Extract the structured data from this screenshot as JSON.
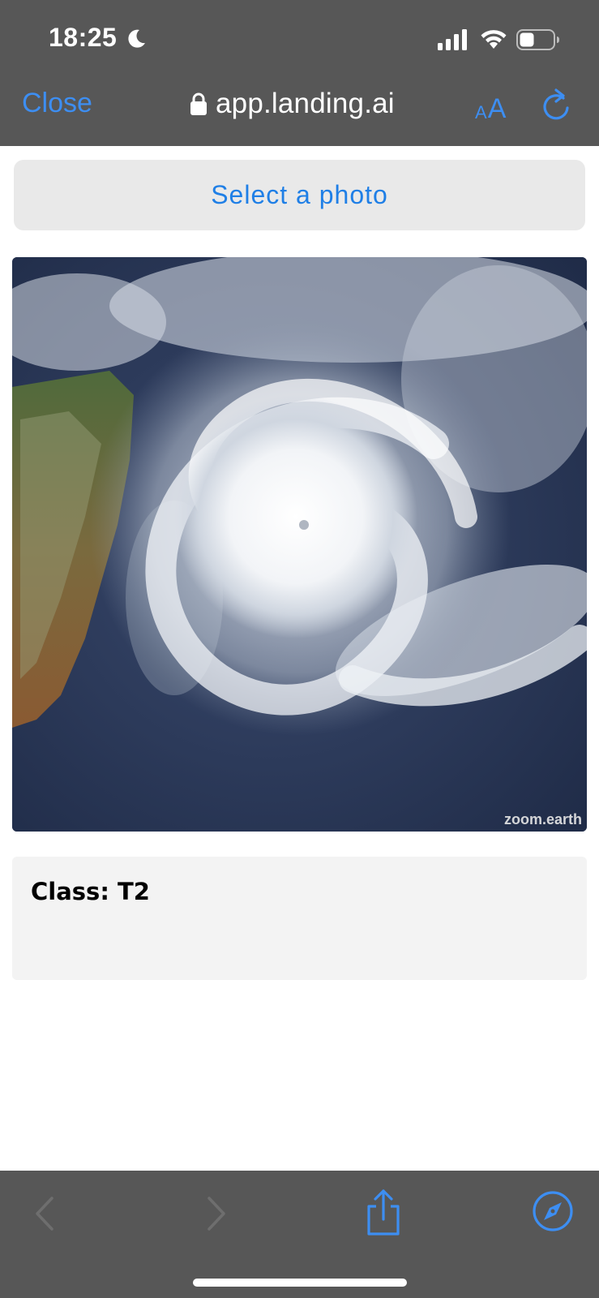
{
  "status_bar": {
    "time": "18:25",
    "icons": [
      "moon-icon",
      "signal-icon",
      "wifi-icon",
      "battery-icon"
    ]
  },
  "browser_nav": {
    "close_label": "Close",
    "url": "app.landing.ai",
    "text_size_label_small": "A",
    "text_size_label_large": "A",
    "icons": [
      "lock-icon",
      "reload-icon"
    ],
    "accent_color": "#3d8ef2"
  },
  "main": {
    "select_photo_label": "Select a photo",
    "image": {
      "description_icon": "satellite-cyclone-image",
      "watermark": "zoom.earth"
    },
    "result": {
      "text": "Class: T2"
    }
  },
  "toolbar": {
    "icons": [
      "back-chevron-icon",
      "forward-chevron-icon",
      "share-icon",
      "compass-icon"
    ],
    "back_enabled": false,
    "forward_enabled": false
  },
  "colors": {
    "chrome_background": "#575757",
    "link_blue": "#1f7fe6",
    "button_background": "#e9e9e9",
    "result_background": "#f3f3f3"
  }
}
